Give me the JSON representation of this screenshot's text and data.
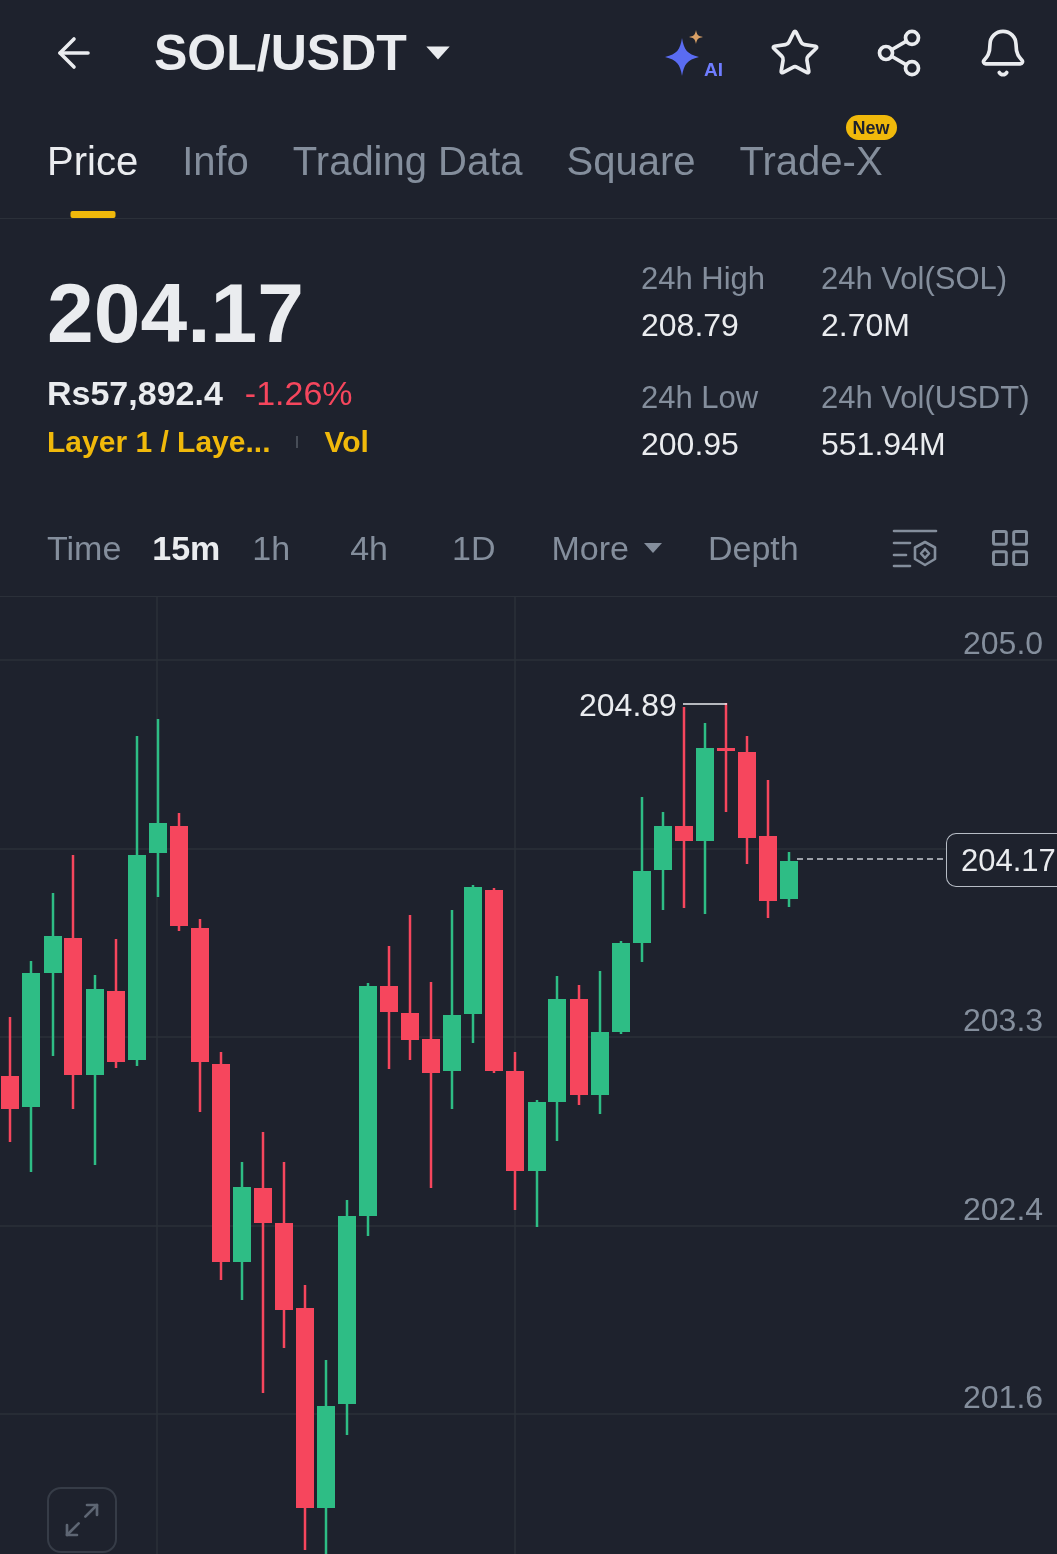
{
  "header": {
    "title": "SOL/USDT",
    "ai_label": "AI"
  },
  "tabs": [
    {
      "label": "Price",
      "selected": true
    },
    {
      "label": "Info",
      "selected": false
    },
    {
      "label": "Trading Data",
      "selected": false
    },
    {
      "label": "Square",
      "selected": false
    },
    {
      "label": "Trade-X",
      "selected": false,
      "badge": "New"
    }
  ],
  "ticker": {
    "last_price": "204.17",
    "fiat_price": "Rs57,892.4",
    "change": "-1.26%",
    "negative": true,
    "sector_tag": "Layer 1 / Laye...",
    "volume_link": "Vol",
    "stats": [
      {
        "label": "24h High",
        "value": "208.79"
      },
      {
        "label": "24h Vol(SOL)",
        "value": "2.70M"
      },
      {
        "label": "24h Low",
        "value": "200.95"
      },
      {
        "label": "24h Vol(USDT)",
        "value": "551.94M"
      }
    ]
  },
  "intervals": [
    {
      "label": "Time",
      "selected": false,
      "kind": "option"
    },
    {
      "label": "15m",
      "selected": true,
      "kind": "option"
    },
    {
      "label": "1h",
      "selected": false,
      "kind": "option"
    },
    {
      "label": "4h",
      "selected": false,
      "kind": "option"
    },
    {
      "label": "1D",
      "selected": false,
      "kind": "option"
    },
    {
      "label": "More",
      "selected": false,
      "kind": "dropdown"
    },
    {
      "label": "Depth",
      "selected": false,
      "kind": "option"
    }
  ],
  "chart": {
    "price_labels": [
      "205.0",
      "203.3",
      "202.4",
      "201.6"
    ],
    "high_label": "204.89",
    "last_price_label": "204.17"
  }
}
